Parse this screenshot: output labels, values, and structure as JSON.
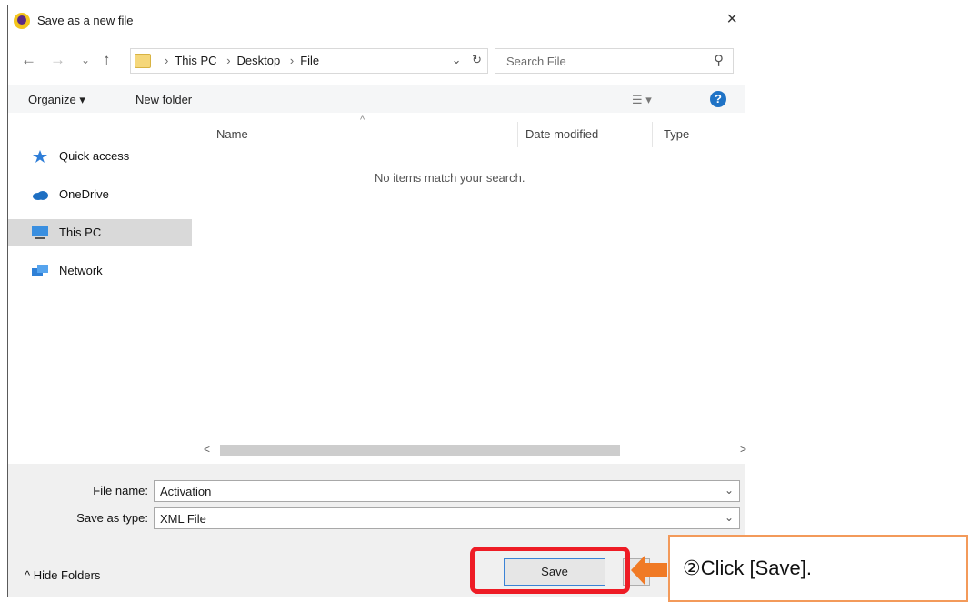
{
  "dialog": {
    "title": "Save as a new file",
    "close_glyph": "×"
  },
  "nav": {
    "back_glyph": "←",
    "forward_glyph": "→",
    "recent_glyph": "⌄",
    "up_glyph": "↑",
    "breadcrumb": [
      "This PC",
      "Desktop",
      "File"
    ],
    "breadcrumb_sep": "›",
    "dropdown_glyph": "⌄",
    "refresh_glyph": "↻",
    "search_placeholder": "Search File",
    "search_glyph": "⚲"
  },
  "toolbar": {
    "organize_label": "Organize ▾",
    "new_folder_label": "New folder",
    "view_glyph": "☰ ▾",
    "help_glyph": "?"
  },
  "sidebar": {
    "items": [
      {
        "label": "Quick access",
        "icon": "star-icon",
        "selected": false
      },
      {
        "label": "OneDrive",
        "icon": "cloud-icon",
        "selected": false
      },
      {
        "label": "This PC",
        "icon": "monitor-icon",
        "selected": true
      },
      {
        "label": "Network",
        "icon": "network-icon",
        "selected": false
      }
    ]
  },
  "content": {
    "columns": [
      "Name",
      "Date modified",
      "Type"
    ],
    "sort_glyph": "^",
    "empty_message": "No items match your search.",
    "scroll_left_glyph": "<",
    "scroll_right_glyph": ">"
  },
  "form": {
    "file_name_label": "File name:",
    "file_name_value": "Activation",
    "save_type_label": "Save as type:",
    "save_type_value": "XML File",
    "chevron_glyph": "⌄"
  },
  "footer": {
    "hide_folders_label": "^ Hide Folders",
    "save_label": "Save"
  },
  "annotation": {
    "callout_text": "②Click [Save].",
    "highlight_color": "#ee1c25",
    "arrow_color": "#f07a25"
  },
  "colors": {
    "accent_blue": "#1f73c6",
    "selected_bg": "#d9d9d9"
  }
}
